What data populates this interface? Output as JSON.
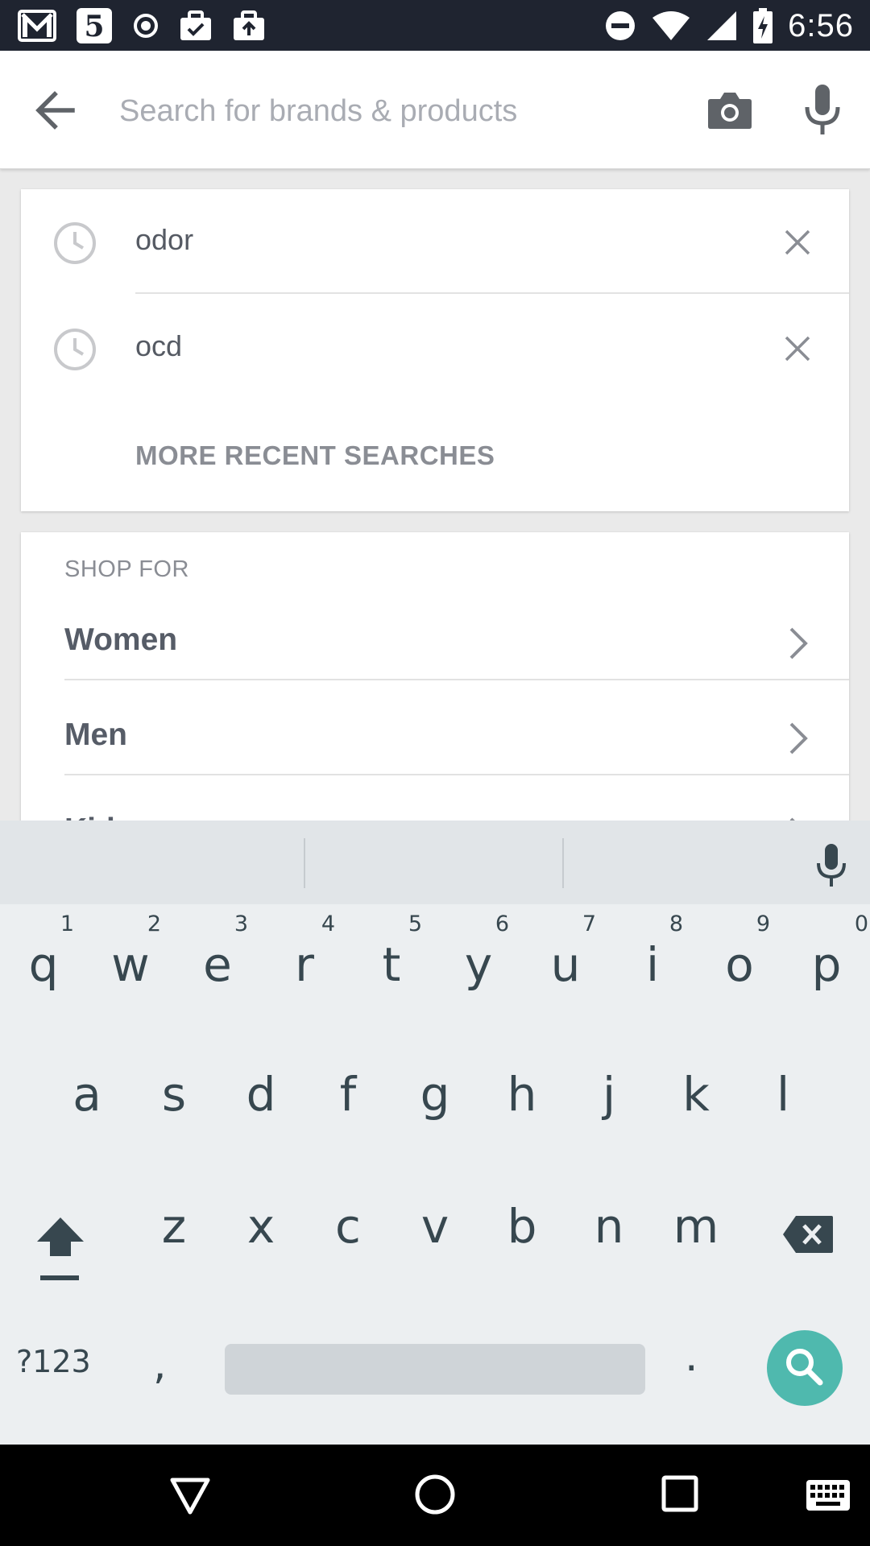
{
  "status_bar": {
    "time": "6:56",
    "left_icons": [
      "gmail-icon",
      "channel-5-icon",
      "record-icon",
      "briefcase-check-icon",
      "briefcase-upload-icon"
    ],
    "right_icons": [
      "do-not-disturb-icon",
      "wifi-icon",
      "signal-icon",
      "battery-charging-icon"
    ]
  },
  "search_bar": {
    "placeholder": "Search for brands & products"
  },
  "recent_searches": {
    "items": [
      {
        "term": "odor"
      },
      {
        "term": "ocd"
      }
    ],
    "more_label": "MORE RECENT SEARCHES"
  },
  "shop_for": {
    "header": "SHOP FOR",
    "items": [
      {
        "label": "Women"
      },
      {
        "label": "Men"
      },
      {
        "label": "Kids"
      }
    ]
  },
  "keyboard": {
    "row1": [
      {
        "key": "q",
        "hint": "1"
      },
      {
        "key": "w",
        "hint": "2"
      },
      {
        "key": "e",
        "hint": "3"
      },
      {
        "key": "r",
        "hint": "4"
      },
      {
        "key": "t",
        "hint": "5"
      },
      {
        "key": "y",
        "hint": "6"
      },
      {
        "key": "u",
        "hint": "7"
      },
      {
        "key": "i",
        "hint": "8"
      },
      {
        "key": "o",
        "hint": "9"
      },
      {
        "key": "p",
        "hint": "0"
      }
    ],
    "row2": [
      "a",
      "s",
      "d",
      "f",
      "g",
      "h",
      "j",
      "k",
      "l"
    ],
    "row3": [
      "z",
      "x",
      "c",
      "v",
      "b",
      "n",
      "m"
    ],
    "symbols_label": "?123",
    "comma": ",",
    "period": "."
  },
  "colors": {
    "status_bar": "#1f2430",
    "accent_search_key": "#4fb9ae",
    "keyboard_bg": "#eceff1"
  }
}
